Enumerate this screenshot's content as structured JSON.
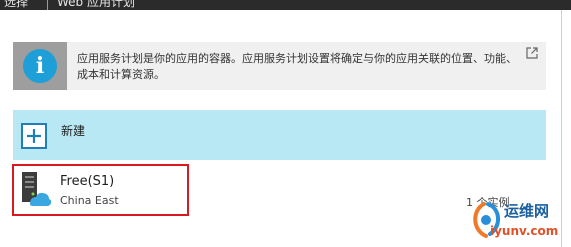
{
  "breadcrumb": {
    "left": "选择",
    "current": "Web 应用计划"
  },
  "info": {
    "icon": "info-icon",
    "text": "应用服务计划是你的应用的容器。应用服务计划设置将确定与你的应用关联的位置、功能、成本和计算资源。",
    "link_icon": "external-link-icon"
  },
  "create": {
    "label": "新建",
    "icon": "plus-icon"
  },
  "plans": [
    {
      "name": "Free(S1)",
      "region": "China East",
      "instances": "1 个实例",
      "icon": "server-cloud-icon",
      "highlighted": true
    }
  ],
  "watermark": {
    "brand": "运维网",
    "url": "iyunv.com"
  },
  "colors": {
    "accent": "#1f9fd8",
    "new_row_bg": "#b9e8f5",
    "highlight_border": "#d9191f",
    "info_bg": "#f0f0f0"
  }
}
